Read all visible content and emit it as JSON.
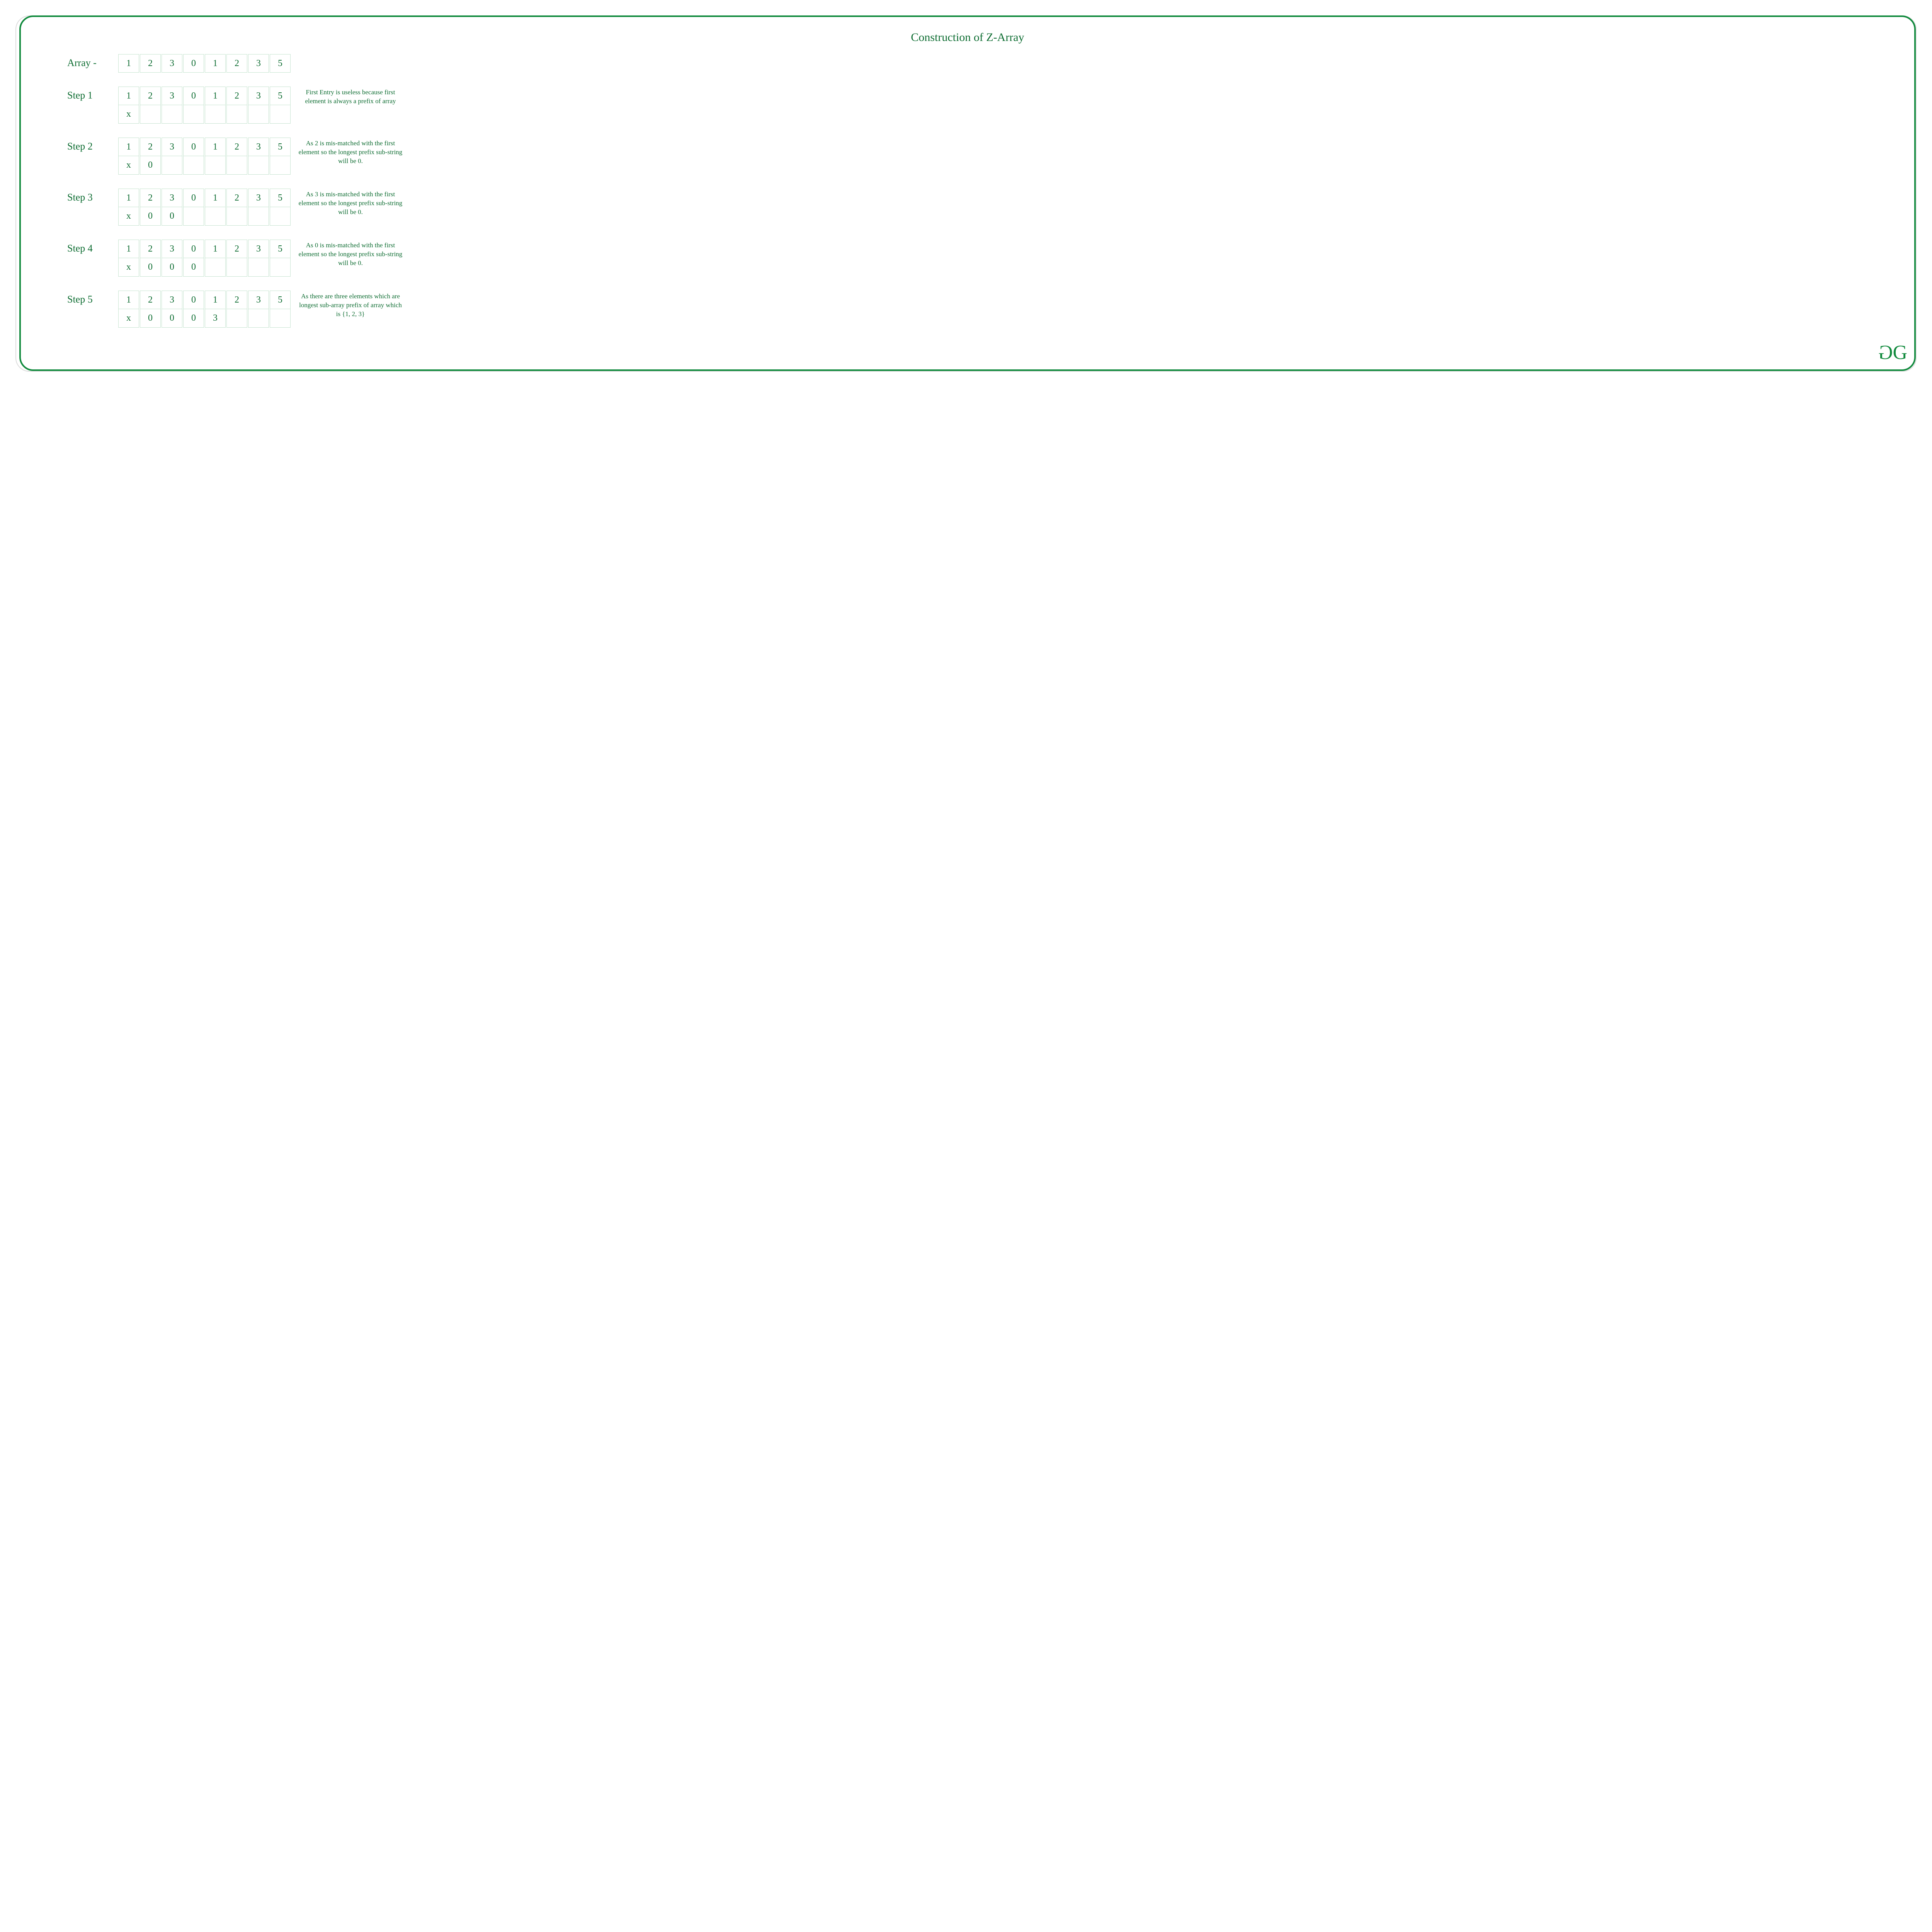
{
  "title": "Construction of Z-Array",
  "labels": {
    "array": "Array -",
    "step1": "Step 1",
    "step2": "Step 2",
    "step3": "Step 3",
    "step4": "Step 4",
    "step5": "Step 5"
  },
  "array": [
    "1",
    "2",
    "3",
    "0",
    "1",
    "2",
    "3",
    "5"
  ],
  "steps": [
    {
      "top": [
        {
          "v": "1"
        },
        {
          "v": "2"
        },
        {
          "v": "3"
        },
        {
          "v": "0"
        },
        {
          "v": "1"
        },
        {
          "v": "2"
        },
        {
          "v": "3"
        },
        {
          "v": "5"
        }
      ],
      "bottom": [
        {
          "v": "x"
        },
        {
          "v": ""
        },
        {
          "v": ""
        },
        {
          "v": ""
        },
        {
          "v": ""
        },
        {
          "v": ""
        },
        {
          "v": ""
        },
        {
          "v": ""
        }
      ],
      "desc": "First Entry is useless because first element is always a prefix of array"
    },
    {
      "top": [
        {
          "v": "1",
          "c": "red"
        },
        {
          "v": "2",
          "c": "grey"
        },
        {
          "v": "3"
        },
        {
          "v": "0"
        },
        {
          "v": "1"
        },
        {
          "v": "2"
        },
        {
          "v": "3"
        },
        {
          "v": "5"
        }
      ],
      "bottom": [
        {
          "v": "x"
        },
        {
          "v": "0"
        },
        {
          "v": ""
        },
        {
          "v": ""
        },
        {
          "v": ""
        },
        {
          "v": ""
        },
        {
          "v": ""
        },
        {
          "v": ""
        }
      ],
      "desc": "As 2 is mis-matched with the first element so the longest prefix sub-string will be 0."
    },
    {
      "top": [
        {
          "v": "1",
          "c": "red"
        },
        {
          "v": "2"
        },
        {
          "v": "3",
          "c": "grey"
        },
        {
          "v": "0"
        },
        {
          "v": "1"
        },
        {
          "v": "2"
        },
        {
          "v": "3"
        },
        {
          "v": "5"
        }
      ],
      "bottom": [
        {
          "v": "x"
        },
        {
          "v": "0"
        },
        {
          "v": "0"
        },
        {
          "v": ""
        },
        {
          "v": ""
        },
        {
          "v": ""
        },
        {
          "v": ""
        },
        {
          "v": ""
        }
      ],
      "desc": "As 3 is mis-matched with the first element so the longest prefix sub-string will be 0."
    },
    {
      "top": [
        {
          "v": "1",
          "c": "red"
        },
        {
          "v": "2"
        },
        {
          "v": "3"
        },
        {
          "v": "0",
          "c": "grey"
        },
        {
          "v": "1"
        },
        {
          "v": "2"
        },
        {
          "v": "3"
        },
        {
          "v": "5"
        }
      ],
      "bottom": [
        {
          "v": "x"
        },
        {
          "v": "0"
        },
        {
          "v": "0"
        },
        {
          "v": "0"
        },
        {
          "v": ""
        },
        {
          "v": ""
        },
        {
          "v": ""
        },
        {
          "v": ""
        }
      ],
      "desc": "As 0 is mis-matched with the first element so the longest prefix sub-string will be 0."
    },
    {
      "top": [
        {
          "v": "1",
          "c": "greenbg"
        },
        {
          "v": "2",
          "c": "greenbg"
        },
        {
          "v": "3",
          "c": "greenbg"
        },
        {
          "v": "0",
          "c": "red"
        },
        {
          "v": "1",
          "c": "grey"
        },
        {
          "v": "2",
          "c": "grey"
        },
        {
          "v": "3",
          "c": "grey"
        },
        {
          "v": "5"
        }
      ],
      "bottom": [
        {
          "v": "x"
        },
        {
          "v": "0"
        },
        {
          "v": "0"
        },
        {
          "v": "0"
        },
        {
          "v": "3"
        },
        {
          "v": ""
        },
        {
          "v": ""
        },
        {
          "v": ""
        }
      ],
      "desc": "As there are three elements which are longest sub-array prefix of array which is {1, 2, 3}"
    }
  ],
  "logo": {
    "glyph1": "G",
    "glyph2": "G"
  },
  "chart_data": {
    "type": "table",
    "title": "Construction of Z-Array",
    "input_array": [
      1,
      2,
      3,
      0,
      1,
      2,
      3,
      5
    ],
    "z_array_progress": [
      {
        "step": 1,
        "z": [
          "x",
          null,
          null,
          null,
          null,
          null,
          null,
          null
        ],
        "highlight_red": [],
        "highlight_green": [],
        "highlight_grey": []
      },
      {
        "step": 2,
        "z": [
          "x",
          0,
          null,
          null,
          null,
          null,
          null,
          null
        ],
        "highlight_red": [
          0
        ],
        "highlight_green": [],
        "highlight_grey": [
          1
        ]
      },
      {
        "step": 3,
        "z": [
          "x",
          0,
          0,
          null,
          null,
          null,
          null,
          null
        ],
        "highlight_red": [
          0
        ],
        "highlight_green": [],
        "highlight_grey": [
          2
        ]
      },
      {
        "step": 4,
        "z": [
          "x",
          0,
          0,
          0,
          null,
          null,
          null,
          null
        ],
        "highlight_red": [
          0
        ],
        "highlight_green": [],
        "highlight_grey": [
          3
        ]
      },
      {
        "step": 5,
        "z": [
          "x",
          0,
          0,
          0,
          3,
          null,
          null,
          null
        ],
        "highlight_red": [
          3
        ],
        "highlight_green": [
          0,
          1,
          2
        ],
        "highlight_grey": [
          4,
          5,
          6
        ]
      }
    ]
  }
}
